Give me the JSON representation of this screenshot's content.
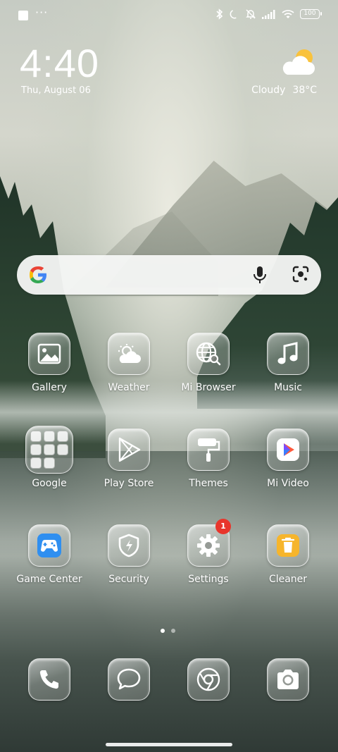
{
  "status_bar": {
    "battery": "100",
    "icons": [
      "square-notification-icon",
      "more-dots-icon",
      "bluetooth-icon",
      "moon-icon",
      "bell-muted-icon",
      "signal-icon",
      "wifi-icon",
      "battery-icon"
    ]
  },
  "clock": {
    "time": "4:40",
    "date": "Thu, August 06"
  },
  "weather": {
    "condition": "Cloudy",
    "temperature": "38°C",
    "icon": "sun-behind-cloud-icon"
  },
  "search": {
    "icons": [
      "google-logo-icon",
      "microphone-icon",
      "google-lens-icon"
    ]
  },
  "apps": [
    {
      "label": "Gallery",
      "icon": "gallery-icon"
    },
    {
      "label": "Weather",
      "icon": "weather-icon"
    },
    {
      "label": "Mi Browser",
      "icon": "browser-icon"
    },
    {
      "label": "Music",
      "icon": "music-icon"
    },
    {
      "label": "Google",
      "icon": "folder-icon"
    },
    {
      "label": "Play Store",
      "icon": "play-store-icon"
    },
    {
      "label": "Themes",
      "icon": "paint-roller-icon"
    },
    {
      "label": "Mi Video",
      "icon": "video-icon"
    },
    {
      "label": "Game Center",
      "icon": "gamepad-icon"
    },
    {
      "label": "Security",
      "icon": "shield-icon"
    },
    {
      "label": "Settings",
      "icon": "gear-icon",
      "badge": "1"
    },
    {
      "label": "Cleaner",
      "icon": "trash-icon"
    }
  ],
  "dock": [
    {
      "icon": "phone-icon"
    },
    {
      "icon": "messages-icon"
    },
    {
      "icon": "chrome-icon"
    },
    {
      "icon": "camera-icon"
    }
  ],
  "page_indicator": {
    "pages": 2,
    "current": 1
  },
  "colors": {
    "badge": "#e8352b",
    "game_center": "#2f8ff0",
    "cleaner": "#f6b52c",
    "mi_video": "#ff5a3c"
  }
}
